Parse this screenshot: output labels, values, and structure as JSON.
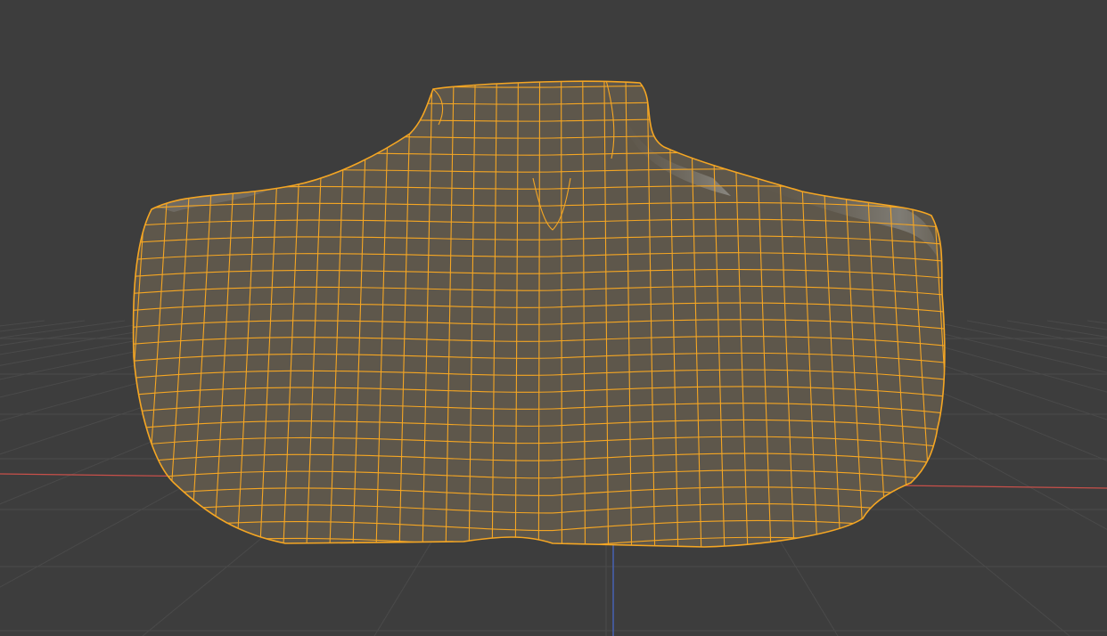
{
  "viewport": {
    "background_color": "#3d3d3d",
    "floor_grid_color": "#4a4a4a",
    "x_axis_color": "#c8504a",
    "z_axis_color": "#4a6ad0"
  },
  "mesh": {
    "object": "torso",
    "selected": true,
    "shading": "solid",
    "surface_color": "#5e574b",
    "surface_shadow_color": "#4f493f",
    "highlight_color": "#8f8f8f",
    "wire_color": "#f5a623"
  }
}
